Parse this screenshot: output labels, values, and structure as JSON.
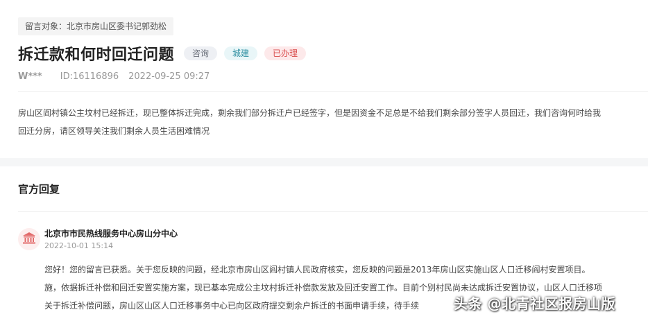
{
  "message_target": "留言对象：北京市房山区委书记郭劲松",
  "title": "拆迁款和何时回迁问题",
  "tags": {
    "consult": "咨询",
    "department": "城建",
    "status": "已办理"
  },
  "meta": {
    "author": "W***",
    "id": "ID:16116896",
    "datetime": "2022-09-25 09:27"
  },
  "content_lines": [
    "房山区阎村镇公主坟村已经拆迁，现已整体拆迁完成，剩余我们部分拆迁户已经签字，但是因资金不足总是不给我们剩余部分签字人员回迁，我们咨询何时给我",
    "回迁分房，请区领导关注我们剩余人员生活困难情况"
  ],
  "official_reply": {
    "section_title": "官方回复",
    "org_icon": "government-building-icon",
    "org_name": "北京市市民热线服务中心房山分中心",
    "date": "2022-10-01 15:14",
    "lines": [
      "您好！您的留言已获悉。关于您反映的问题，经北京市房山区阎村镇人民政府核实，您反映的问题是2013年房山区实施山区人口迁移阎村安置项目。",
      "施，依据拆迁补偿和回迁安置实施方案，现已基本完成公主坟村拆迁补偿款发放及回迁安置工作。目前个别村民尚未达成拆迁安置协议，山区人口迁移项",
      "关于拆迁补偿问题，房山区山区人口迁移事务中心已向区政府提交剩余户拆迁的书面申请手续，待手续"
    ]
  },
  "watermark": "头条 @北青社区报房山版",
  "colors": {
    "status_red": "#d94a4a",
    "dept_teal": "#2e8fa1",
    "avatar_bg": "#fdeeee",
    "avatar_icon": "#e26b6b"
  }
}
